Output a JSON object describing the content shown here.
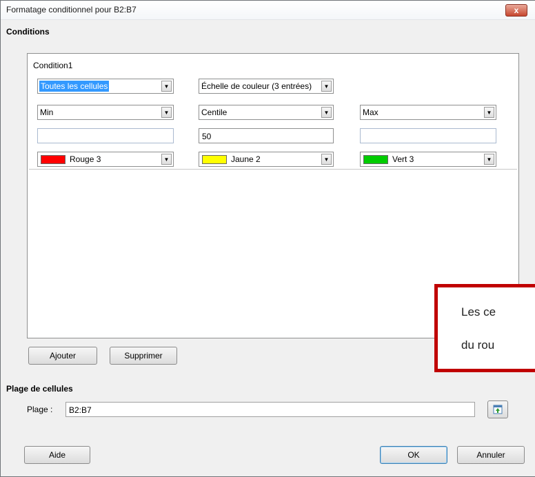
{
  "window": {
    "title": "Formatage conditionnel pour B2:B7",
    "close_label": "x"
  },
  "conditions": {
    "section_label": "Conditions",
    "condition_title": "Condition1",
    "cell_scope": "Toutes les cellules",
    "format_type": "Échelle de couleur (3 entrées)",
    "columns": [
      {
        "type": "Min",
        "value": "",
        "color_name": "Rouge 3",
        "color": "#ff0000"
      },
      {
        "type": "Centile",
        "value": "50",
        "color_name": "Jaune 2",
        "color": "#ffff00"
      },
      {
        "type": "Max",
        "value": "",
        "color_name": "Vert 3",
        "color": "#00cc00"
      }
    ]
  },
  "buttons": {
    "add": "Ajouter",
    "delete": "Supprimer",
    "help": "Aide",
    "ok": "OK",
    "cancel": "Annuler"
  },
  "range": {
    "section_label": "Plage de cellules",
    "field_label": "Plage :",
    "value": "B2:B7"
  },
  "callout": {
    "line1": "Les ce",
    "line2": "du rou",
    "border_color": "#c00000"
  }
}
